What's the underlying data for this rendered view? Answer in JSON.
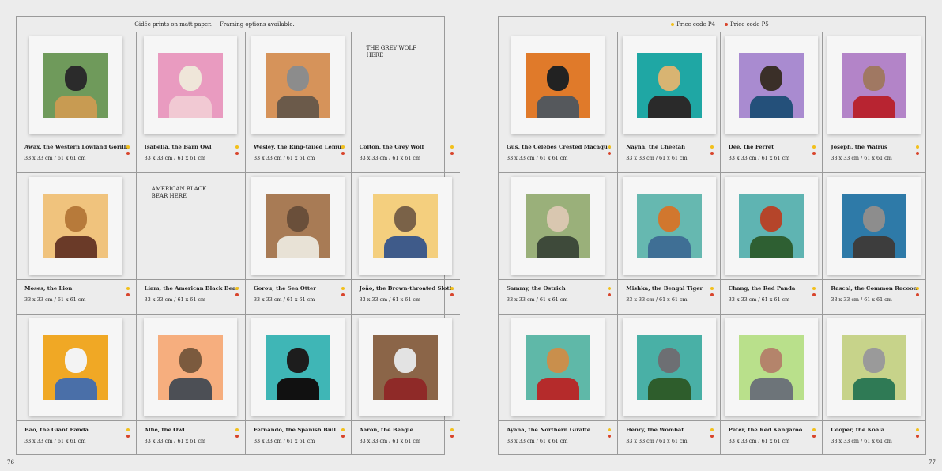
{
  "colors": {
    "p4": "#f2c01b",
    "p5": "#d8442b"
  },
  "left_page": {
    "header_text_1": "Gidée prints on matt paper.",
    "header_text_2": "Framing options available.",
    "page_number": "76",
    "items": [
      {
        "name": "Awax, the Western Lowland Gorilla",
        "size": "33 x 33 cm / 61 x 61 cm",
        "bg": "#6f9a5b",
        "head": "#2b2b2b",
        "body": "#c89b52"
      },
      {
        "name": "Isabella, the Barn Owl",
        "size": "33 x 33 cm / 61 x 61 cm",
        "bg": "#e99bc0",
        "head": "#efe6d9",
        "body": "#f1c9d3"
      },
      {
        "name": "Wesley, the Ring-tailed Lemur",
        "size": "33 x 33 cm / 61 x 61 cm",
        "bg": "#d6935a",
        "head": "#8c8c8c",
        "body": "#6b5a4a"
      },
      {
        "name": "Colton, the Grey Wolf",
        "size": "33 x 33 cm / 61 x 61 cm",
        "placeholder": "THE GREY WOLF HERE"
      },
      {
        "name": "Moses, the Lion",
        "size": "33 x 33 cm / 61 x 61 cm",
        "bg": "#f0c37d",
        "head": "#b77a3a",
        "body": "#6a3a28"
      },
      {
        "name": "Liam, the American Black Bear",
        "size": "33 x 33 cm / 61 x 61 cm",
        "placeholder": "AMERICAN BLACK BEAR HERE"
      },
      {
        "name": "Gorou, the Sea Otter",
        "size": "33 x 33 cm / 61 x 61 cm",
        "bg": "#a87b55",
        "head": "#6a4f3a",
        "body": "#e8e2d6"
      },
      {
        "name": "João, the Brown-throated Sloth",
        "size": "33 x 33 cm / 61 x 61 cm",
        "bg": "#f4cf7e",
        "head": "#7a6248",
        "body": "#3f5b8a"
      },
      {
        "name": "Bao, the Giant Panda",
        "size": "33 x 33 cm / 61 x 61 cm",
        "bg": "#f0a825",
        "head": "#f3f3f3",
        "body": "#4a6fa8"
      },
      {
        "name": "Alfie, the Owl",
        "size": "33 x 33 cm / 61 x 61 cm",
        "bg": "#f6ae7e",
        "head": "#7b5a3e",
        "body": "#4c4f55"
      },
      {
        "name": "Fernando, the Spanish Bull",
        "size": "33 x 33 cm / 61 x 61 cm",
        "bg": "#3fb6b6",
        "head": "#1d1d1d",
        "body": "#111111"
      },
      {
        "name": "Aaron, the Beagle",
        "size": "33 x 33 cm / 61 x 61 cm",
        "bg": "#8b6548",
        "head": "#e3e3e3",
        "body": "#8f2a28"
      }
    ]
  },
  "right_page": {
    "legend_p4": "Price code P4",
    "legend_p5": "Price code P5",
    "page_number": "77",
    "items": [
      {
        "name": "Gus, the Celebes Crested Macaque",
        "size": "33 x 33 cm / 61 x 61 cm",
        "bg": "#e07a2a",
        "head": "#222222",
        "body": "#55585c"
      },
      {
        "name": "Nayna, the Cheetah",
        "size": "33 x 33 cm / 61 x 61 cm",
        "bg": "#1fa7a4",
        "head": "#d8b472",
        "body": "#2a2a2a"
      },
      {
        "name": "Dee, the Ferret",
        "size": "33 x 33 cm / 61 x 61 cm",
        "bg": "#a98bd0",
        "head": "#3a2f28",
        "body": "#24507a"
      },
      {
        "name": "Joseph, the Walrus",
        "size": "33 x 33 cm / 61 x 61 cm",
        "bg": "#b384c8",
        "head": "#a07862",
        "body": "#b82431"
      },
      {
        "name": "Sammy, the Ostrich",
        "size": "33 x 33 cm / 61 x 61 cm",
        "bg": "#9ab07a",
        "head": "#d9c7b0",
        "body": "#3e4a3a"
      },
      {
        "name": "Mishka, the Bengal Tiger",
        "size": "33 x 33 cm / 61 x 61 cm",
        "bg": "#66b8b0",
        "head": "#d1772e",
        "body": "#3f6f95"
      },
      {
        "name": "Chang, the Red Panda",
        "size": "33 x 33 cm / 61 x 61 cm",
        "bg": "#5fb4b2",
        "head": "#b5452a",
        "body": "#2e5f32"
      },
      {
        "name": "Rascal, the Common Racoon",
        "size": "33 x 33 cm / 61 x 61 cm",
        "bg": "#2e7aa8",
        "head": "#8d8d8d",
        "body": "#3d3d3d"
      },
      {
        "name": "Ayana, the Northern Giraffe",
        "size": "33 x 33 cm / 61 x 61 cm",
        "bg": "#5fb8a8",
        "head": "#c98f4c",
        "body": "#b52b2b"
      },
      {
        "name": "Henry, the Wombat",
        "size": "33 x 33 cm / 61 x 61 cm",
        "bg": "#49b0a6",
        "head": "#6d6f73",
        "body": "#2e5d2c"
      },
      {
        "name": "Peter, the Red Kangaroo",
        "size": "33 x 33 cm / 61 x 61 cm",
        "bg": "#b9e08b",
        "head": "#b4846b",
        "body": "#6d7479"
      },
      {
        "name": "Cooper, the Koala",
        "size": "33 x 33 cm / 61 x 61 cm",
        "bg": "#c7d38a",
        "head": "#9a9a9a",
        "body": "#2f7a55"
      }
    ]
  }
}
